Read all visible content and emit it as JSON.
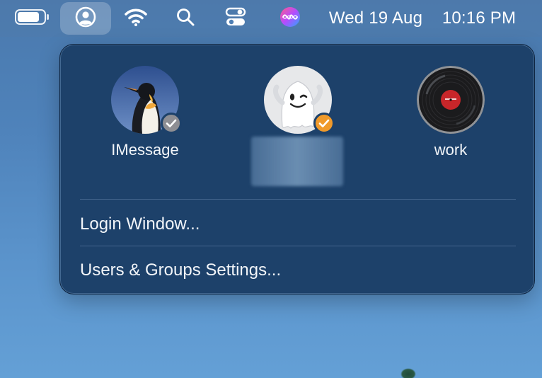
{
  "menubar": {
    "icons": {
      "battery": "battery-icon",
      "user": "user-circle-icon",
      "wifi": "wifi-icon",
      "search": "search-icon",
      "control_center": "control-center-icon",
      "siri": "siri-icon"
    },
    "date": "Wed 19 Aug",
    "time": "10:16 PM"
  },
  "popover": {
    "users": [
      {
        "name": "IMessage",
        "avatar": "penguin-avatar",
        "check_color": "#8e8e93",
        "active": false
      },
      {
        "name": "",
        "avatar": "ghost-avatar",
        "check_color": "#f09a2b",
        "active": true,
        "name_obscured": true
      },
      {
        "name": "work",
        "avatar": "vinyl-record-avatar",
        "check_color": null,
        "active": false
      }
    ],
    "menu": {
      "login_window": "Login Window...",
      "users_groups_settings": "Users & Groups Settings..."
    }
  },
  "colors": {
    "popover_bg": "#1d416a",
    "desktop_bg": "#4f83bb",
    "check_gray": "#8e8e93",
    "check_orange": "#f09a2b"
  }
}
